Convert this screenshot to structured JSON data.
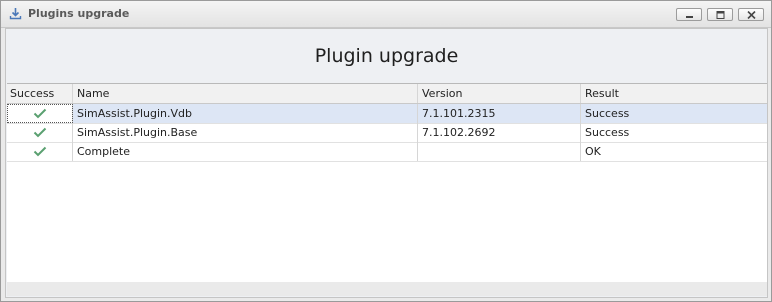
{
  "window": {
    "title": "Plugins upgrade",
    "title_icon": "download-icon",
    "controls": [
      "minimize-icon",
      "maximize-icon",
      "close-icon"
    ]
  },
  "heading": "Plugin upgrade",
  "grid": {
    "columns": [
      "Success",
      "Name",
      "Version",
      "Result"
    ],
    "rows": [
      {
        "success": true,
        "name": "SimAssist.Plugin.Vdb",
        "version": "7.1.101.2315",
        "result": "Success"
      },
      {
        "success": true,
        "name": "SimAssist.Plugin.Base",
        "version": "7.1.102.2692",
        "result": "Success"
      },
      {
        "success": true,
        "name": "Complete",
        "version": "",
        "result": "OK"
      }
    ],
    "selected_row": 0
  },
  "colors": {
    "check": "#5aa070",
    "selection": "#dde6f5",
    "title_icon": "#4a78b8"
  }
}
